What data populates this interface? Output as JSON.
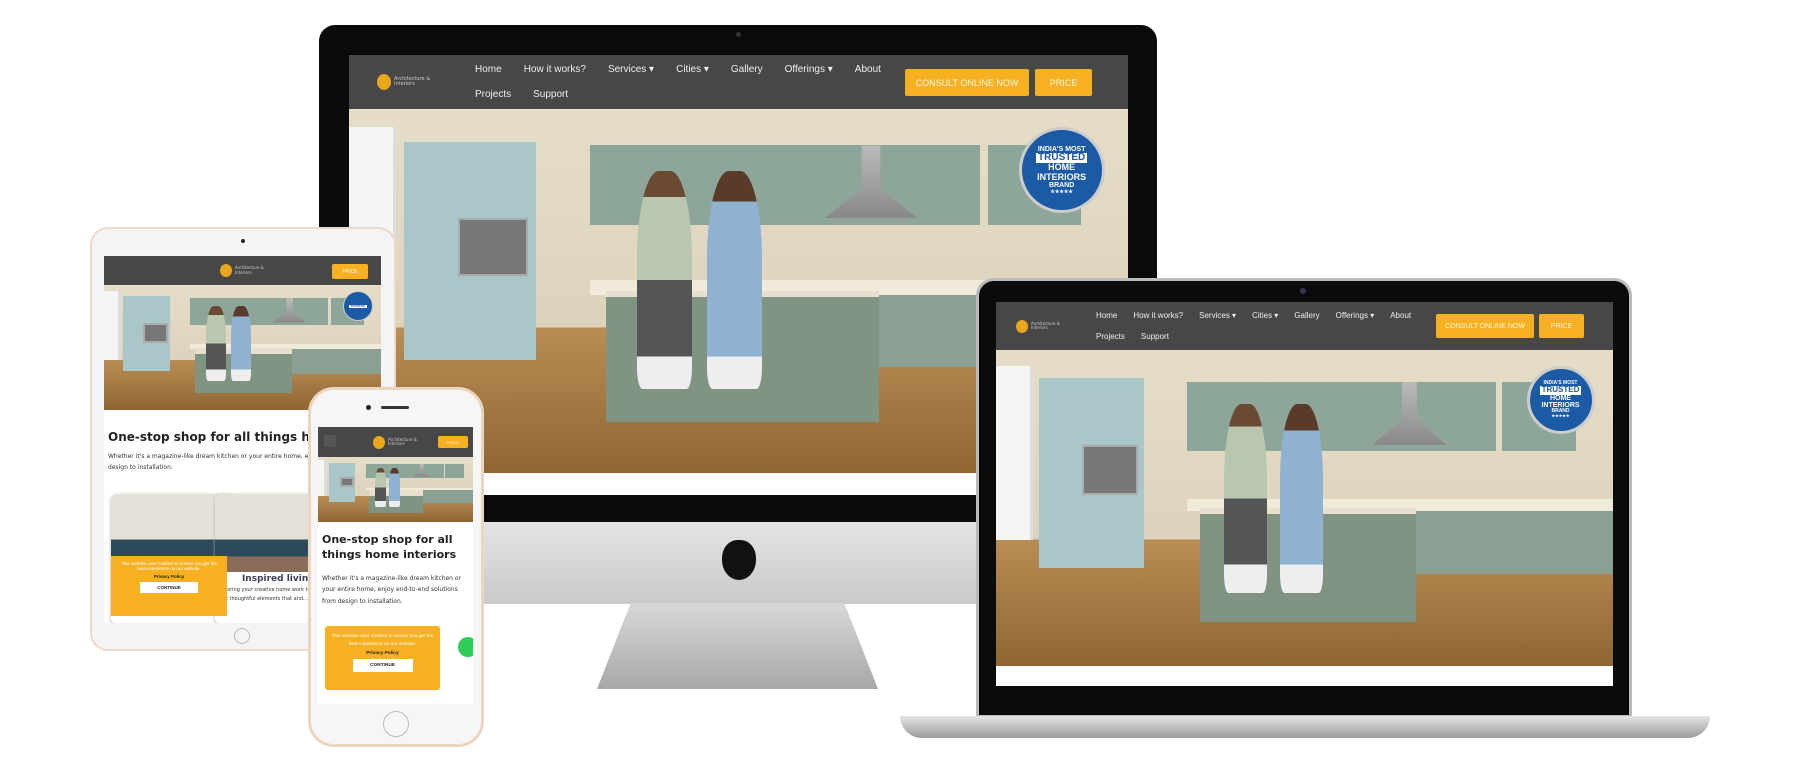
{
  "site": {
    "logo_text": "Architecture & Interiors",
    "nav": [
      "Home",
      "How it works?",
      "Services ▾",
      "Cities ▾",
      "Gallery",
      "Offerings ▾",
      "About",
      "Projects",
      "Support"
    ],
    "consult_label": "CONSULT ONLINE NOW",
    "price_label": "PRICE",
    "badge": {
      "top": "INDIA'S MOST",
      "trusted": "TRUSTED",
      "home": "HOME",
      "interiors": "INTERIORS",
      "brand": "BRAND",
      "stars": "★★★★★"
    },
    "headline": "One-stop shop for all things home interiors",
    "body": "Whether it's a magazine-like dream kitchen or your entire home, enjoy end-to-end solutions from design to installation.",
    "card_title": "Inspired living Designs",
    "card_body": "Tailoring your creative home work together beautifully spaces. Get thoughtful elements that and...",
    "cookie": {
      "text": "This website uses cookies to ensure you get the best experience on our website.",
      "policy": "Privacy Policy",
      "continue": "CONTINUE"
    }
  },
  "colors": {
    "accent": "#f7b021",
    "nav_bg": "#474747",
    "badge": "#1d5aa6"
  }
}
